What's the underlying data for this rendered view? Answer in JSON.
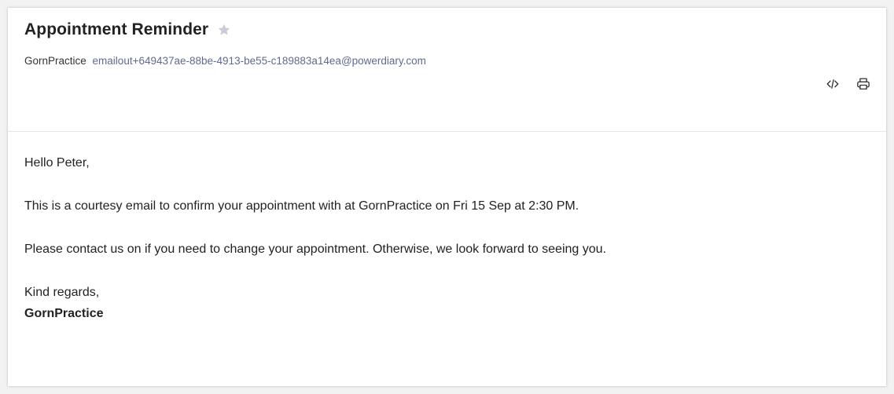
{
  "email": {
    "subject": "Appointment Reminder",
    "sender_name": "GornPractice",
    "sender_email": "emailout+649437ae-88be-4913-be55-c189883a14ea@powerdiary.com",
    "star_icon": "star-icon",
    "star_color": "#c9ccd6",
    "link_color": "#5f6b8f"
  },
  "actions": {
    "view_source_icon": "code-icon",
    "print_icon": "printer-icon"
  },
  "body": {
    "greeting": "Hello Peter,",
    "paragraph_1": "This is a courtesy email to confirm your appointment with at GornPractice on Fri 15 Sep at 2:30 PM.",
    "paragraph_2": "Please contact us on if you need to change your appointment. Otherwise, we look forward to seeing you.",
    "closing": "Kind regards,",
    "signature": "GornPractice"
  }
}
